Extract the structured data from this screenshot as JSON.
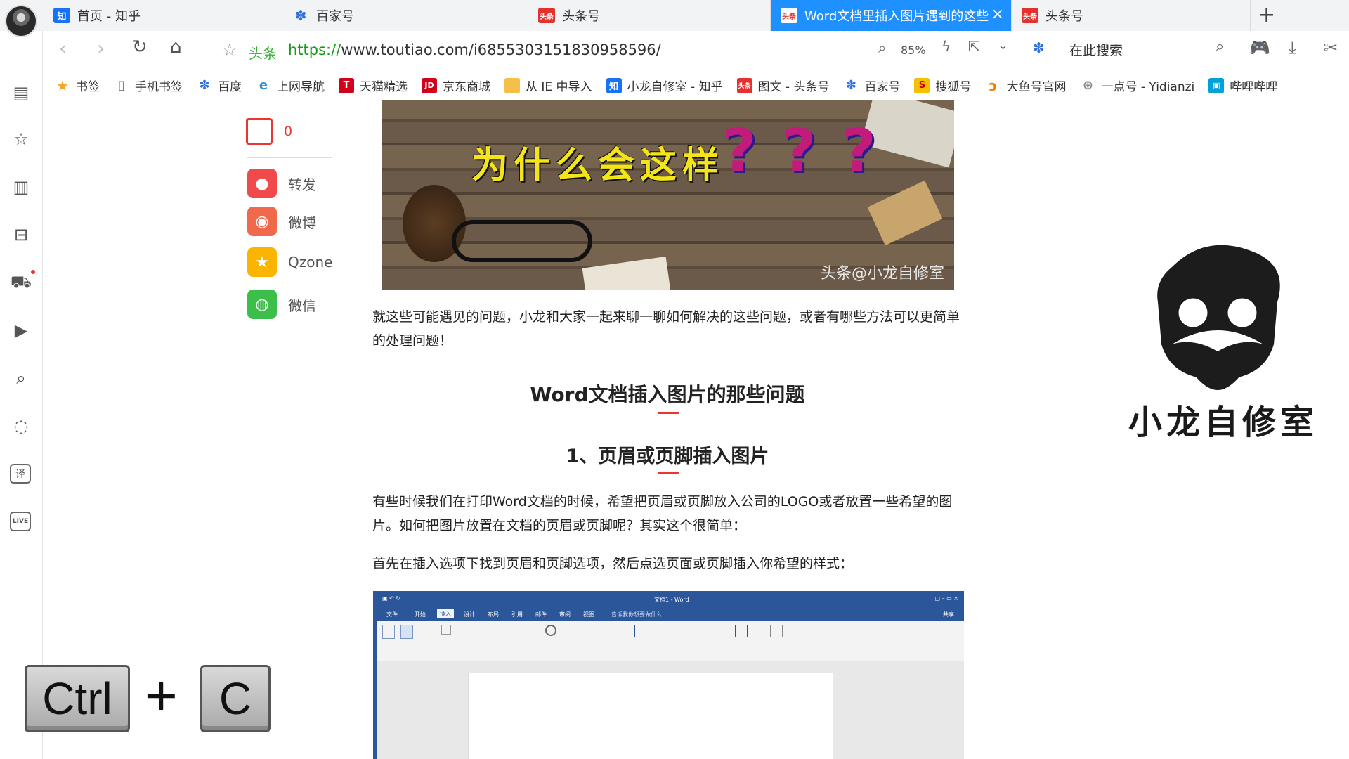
{
  "tabs": [
    {
      "label": "首页 - 知乎",
      "favicon": "知",
      "color": "#1772f6"
    },
    {
      "label": "百家号",
      "favicon": "baidu-paw",
      "color": "#2f6fe0"
    },
    {
      "label": "头条号",
      "favicon": "头条",
      "color": "#e3312e"
    },
    {
      "label": "Word文档里插入图片遇到的这些",
      "favicon": "头条",
      "color": "#e3312e",
      "active": true
    },
    {
      "label": "头条号",
      "favicon": "头条",
      "color": "#e3312e"
    }
  ],
  "address": {
    "site_label": "头条",
    "url_scheme": "https://",
    "url_rest": "www.toutiao.com/i6855303151830958596/",
    "zoom": "85%",
    "search_placeholder": "在此搜索"
  },
  "bookmarks": [
    {
      "label": "书签",
      "icon": "star-icon",
      "color": "#f5a623"
    },
    {
      "label": "手机书签",
      "icon": "phone-icon",
      "color": "#888888"
    },
    {
      "label": "百度",
      "icon": "baidu-paw-icon",
      "color": "#2f6fe0"
    },
    {
      "label": "上网导航",
      "icon": "ie-icon",
      "color": "#2a8de0"
    },
    {
      "label": "天猫精选",
      "icon": "tmall-icon",
      "color": "#d0021b"
    },
    {
      "label": "京东商城",
      "icon": "jd-icon",
      "color": "#d0021b"
    },
    {
      "label": "从 IE 中导入",
      "icon": "folder-icon",
      "color": "#f5c04a"
    },
    {
      "label": "小龙自修室 - 知乎",
      "icon": "zhihu-icon",
      "color": "#1772f6"
    },
    {
      "label": "图文 - 头条号",
      "icon": "toutiao-icon",
      "color": "#e3312e"
    },
    {
      "label": "百家号",
      "icon": "baidu-paw-icon",
      "color": "#2f6fe0"
    },
    {
      "label": "搜狐号",
      "icon": "sohu-icon",
      "color": "#f5c000"
    },
    {
      "label": "大鱼号官网",
      "icon": "dayu-icon",
      "color": "#ff7a00"
    },
    {
      "label": "一点号 - Yidianzi",
      "icon": "globe-icon",
      "color": "#888888"
    },
    {
      "label": "哔哩哔哩",
      "icon": "bilibili-icon",
      "color": "#00a1d6"
    }
  ],
  "sidebar": [
    "news-icon",
    "star-icon",
    "book-icon",
    "bag-icon",
    "cart-icon",
    "video-icon",
    "search-icon",
    "chat-icon",
    "译",
    "LIVE"
  ],
  "share": {
    "comment_count": "0",
    "items": [
      {
        "label": "转发",
        "color": "#f04a4a",
        "icon": "repost-icon"
      },
      {
        "label": "微博",
        "color": "#f0694a",
        "icon": "weibo-icon"
      },
      {
        "label": "Qzone",
        "color": "#fbb500",
        "icon": "qzone-icon"
      },
      {
        "label": "微信",
        "color": "#3cbf4a",
        "icon": "wechat-icon"
      }
    ]
  },
  "article": {
    "banner_title": "为什么会这样",
    "banner_qmarks": [
      "?",
      "?",
      "?"
    ],
    "banner_watermark": "头条@小龙自修室",
    "para1": "就这些可能遇见的问题，小龙和大家一起来聊一聊如何解决的这些问题，或者有哪些方法可以更简单的处理问题！",
    "h2": "Word文档插入图片的那些问题",
    "h3": "1、页眉或页脚插入图片",
    "para2": "有些时候我们在打印Word文档的时候，希望把页眉或页脚放入公司的LOGO或者放置一些希望的图片。如何把图片放置在文档的页眉或页脚呢？其实这个很简单：",
    "para3": "首先在插入选项下找到页眉和页脚选项，然后点选页面或页脚插入你希望的样式："
  },
  "word_screenshot": {
    "title": "文档1 - Word",
    "tabs": [
      "文件",
      "开始",
      "插入",
      "设计",
      "布局",
      "引用",
      "邮件",
      "审阅",
      "视图"
    ],
    "share": "共享",
    "search_hint": "告诉我你想要做什么..."
  },
  "logo": {
    "text": "小龙自修室"
  },
  "keys": {
    "ctrl": "Ctrl",
    "plus": "+",
    "c": "C"
  }
}
